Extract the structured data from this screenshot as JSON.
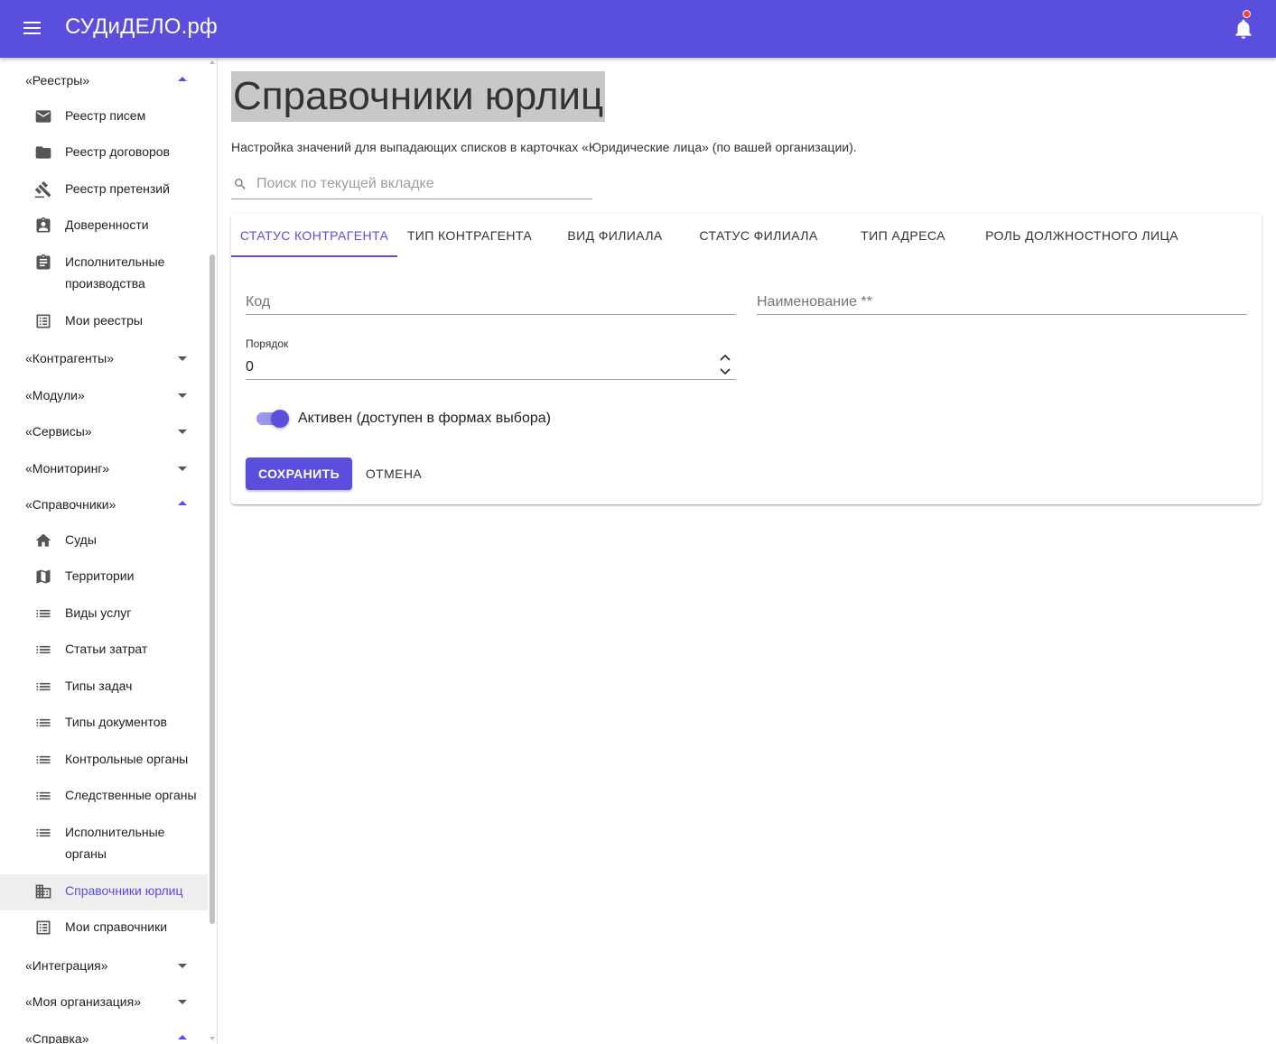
{
  "app": {
    "title": "СУДиДЕЛО.рф"
  },
  "sidebar": {
    "reestry": {
      "label": "«Реестры»",
      "items": [
        {
          "label": "Реестр писем",
          "icon": "mail-icon"
        },
        {
          "label": "Реестр договоров",
          "icon": "folder-icon"
        },
        {
          "label": "Реестр претензий",
          "icon": "gavel-icon"
        },
        {
          "label": "Доверенности",
          "icon": "assignment-ind-icon"
        },
        {
          "label": "Исполнительные производства",
          "icon": "assignment-icon"
        },
        {
          "label": "Мои реестры",
          "icon": "list-alt-icon"
        }
      ]
    },
    "kontragenty": {
      "label": "«Контрагенты»"
    },
    "moduli": {
      "label": "«Модули»"
    },
    "servisy": {
      "label": "«Сервисы»"
    },
    "monitoring": {
      "label": "«Мониторинг»"
    },
    "spravochniki": {
      "label": "«Справочники»",
      "items": [
        {
          "label": "Суды",
          "icon": "home-icon"
        },
        {
          "label": "Территории",
          "icon": "map-icon"
        },
        {
          "label": "Виды услуг",
          "icon": "list-icon"
        },
        {
          "label": "Статьи затрат",
          "icon": "list-icon"
        },
        {
          "label": "Типы задач",
          "icon": "list-icon"
        },
        {
          "label": "Типы документов",
          "icon": "list-icon"
        },
        {
          "label": "Контрольные органы",
          "icon": "list-icon"
        },
        {
          "label": "Следственные органы",
          "icon": "list-icon"
        },
        {
          "label": "Исполнительные органы",
          "icon": "list-icon"
        },
        {
          "label": "Справочники юрлиц",
          "icon": "business-icon",
          "active": true
        },
        {
          "label": "Мои справочники",
          "icon": "list-alt-icon"
        }
      ]
    },
    "integraciya": {
      "label": "«Интеграция»"
    },
    "moya_org": {
      "label": "«Моя организация»"
    },
    "spravka": {
      "label": "«Справка»"
    }
  },
  "main": {
    "title": "Справочники юрлиц",
    "description": "Настройка значений для выпадающих списков в карточках «Юридические лица» (по вашей организации).",
    "search": {
      "placeholder": "Поиск по текущей вкладке",
      "value": ""
    },
    "tabs": [
      {
        "label": "СТАТУС КОНТРАГЕНТА",
        "active": true
      },
      {
        "label": "ТИП КОНТРАГЕНТА"
      },
      {
        "label": "ВИД ФИЛИАЛА"
      },
      {
        "label": "СТАТУС ФИЛИАЛА"
      },
      {
        "label": "ТИП АДРЕСА"
      },
      {
        "label": "РОЛЬ ДОЛЖНОСТНОГО ЛИЦА"
      }
    ],
    "form": {
      "code": {
        "placeholder": "Код",
        "value": ""
      },
      "name": {
        "placeholder": "Наименование **",
        "value": ""
      },
      "order": {
        "label": "Порядок",
        "value": "0"
      },
      "active_toggle": {
        "label": "Активен (доступен в формах выбора)",
        "checked": true
      },
      "save_label": "СОХРАНИТЬ",
      "cancel_label": "ОТМЕНА"
    }
  },
  "colors": {
    "accent": "#5a4fdc",
    "appbar": "#5a4fdc",
    "active_bg": "#eeeeee",
    "notification": "#f44336"
  }
}
